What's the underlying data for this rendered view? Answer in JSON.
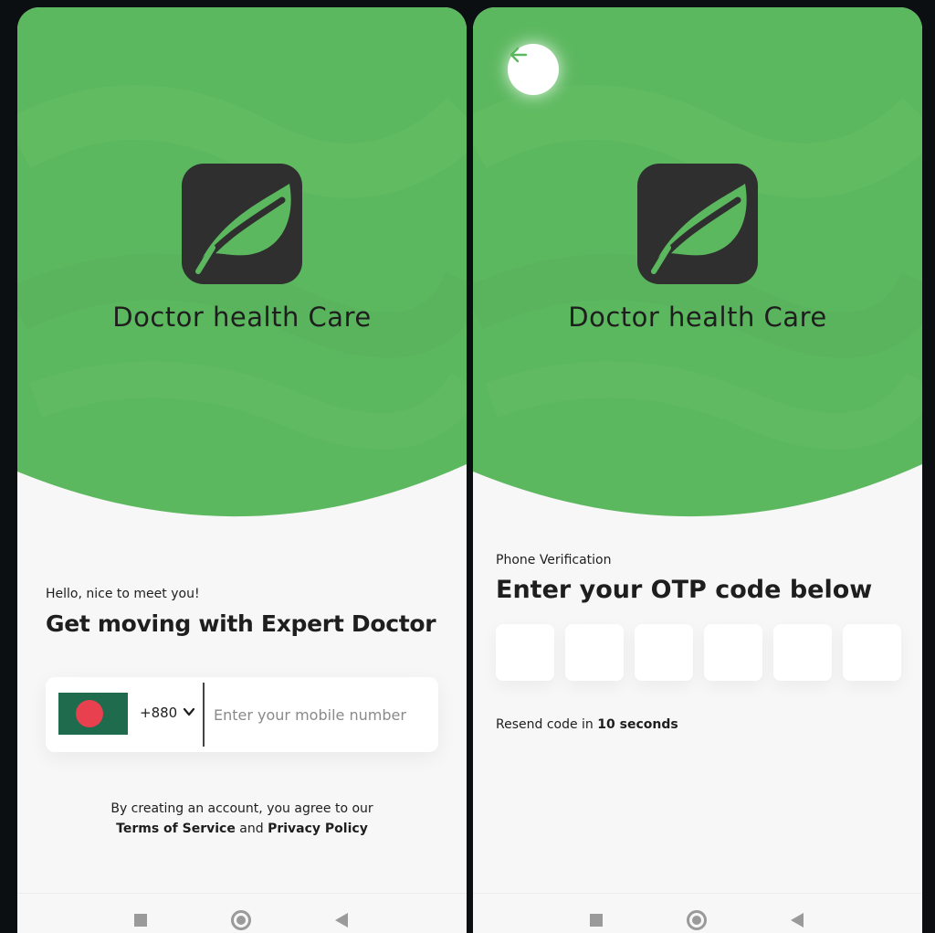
{
  "colors": {
    "brand_green": "#5cb85f",
    "logo_dark": "#2f2f2f",
    "text": "#1e1e1e",
    "flag_green": "#1e6b4e",
    "flag_red": "#e8404f"
  },
  "login": {
    "brand_name": "Doctor health Care",
    "greeting": "Hello, nice to meet you!",
    "headline": "Get moving with Expert Doctor",
    "country_code": "+880",
    "mobile_placeholder": "Enter your mobile number",
    "terms_prefix": "By creating an account, you agree to our",
    "terms_link": "Terms of Service",
    "terms_and": "and",
    "privacy_link": "Privacy Policy"
  },
  "otp": {
    "brand_name": "Doctor health Care",
    "label": "Phone Verification",
    "headline": "Enter your OTP code below",
    "boxes": [
      "",
      "",
      "",
      "",
      "",
      ""
    ],
    "resend_prefix": "Resend code in",
    "resend_timer": "10 seconds"
  },
  "icons": {
    "logo": "leaf-icon",
    "back": "arrow-left-icon",
    "country_dropdown": "chevron-down-icon",
    "flag": "bangladesh-flag-icon",
    "nav_recents": "square-icon",
    "nav_home": "circle-icon",
    "nav_back": "triangle-back-icon"
  }
}
